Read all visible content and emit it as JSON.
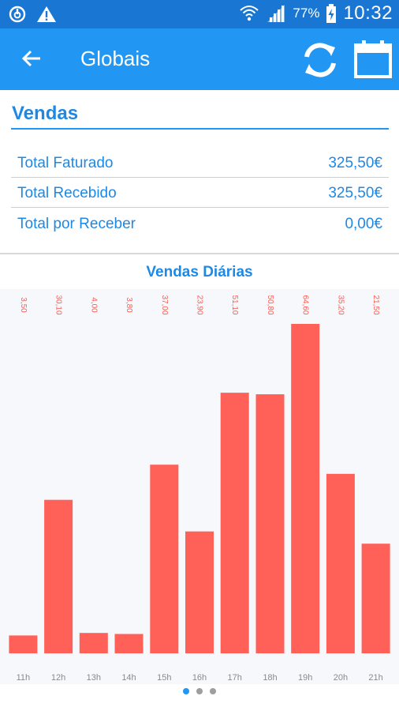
{
  "status_bar": {
    "battery": "77%",
    "time": "10:32"
  },
  "app_bar": {
    "title": "Globais"
  },
  "sales": {
    "section_title": "Vendas",
    "rows": [
      {
        "label": "Total Faturado",
        "value": "325,50€"
      },
      {
        "label": "Total Recebido",
        "value": "325,50€"
      },
      {
        "label": "Total por Receber",
        "value": "0,00€"
      }
    ]
  },
  "chart_data": {
    "type": "bar",
    "title": "Vendas Diárias",
    "categories": [
      "11h",
      "12h",
      "13h",
      "14h",
      "15h",
      "16h",
      "17h",
      "18h",
      "19h",
      "20h",
      "21h"
    ],
    "values": [
      3.5,
      30.1,
      4.0,
      3.8,
      37.0,
      23.9,
      51.1,
      50.8,
      64.6,
      35.2,
      21.5
    ],
    "value_labels": [
      "3,50",
      "30,10",
      "4,00",
      "3,80",
      "37,00",
      "23,90",
      "51,10",
      "50,80",
      "64,60",
      "35,20",
      "21,50"
    ],
    "bar_color": "#FF6159",
    "label_color": "#FF5A4F"
  },
  "pager": {
    "pages": 3,
    "active": 0
  },
  "colors": {
    "status_bar": "#1976D2",
    "app_bar": "#2196F3",
    "accent": "#1E88E5"
  }
}
